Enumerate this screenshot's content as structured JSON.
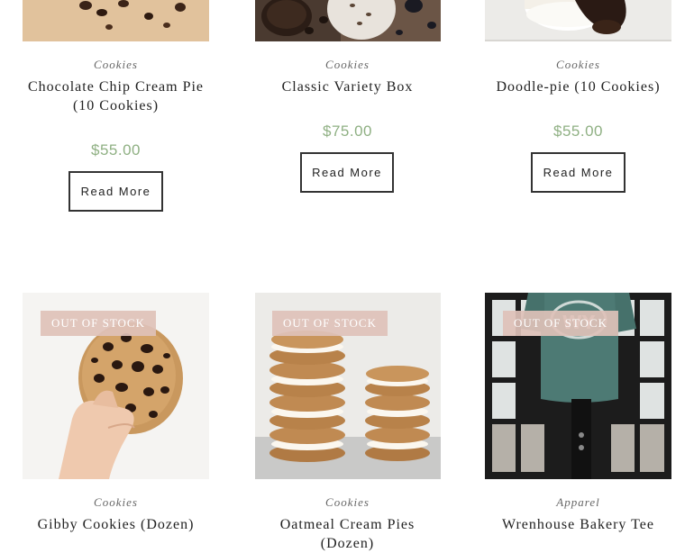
{
  "products": [
    {
      "category": "Cookies",
      "title": "Chocolate Chip Cream Pie (10 Cookies)",
      "price": "$55.00",
      "button": "Read More"
    },
    {
      "category": "Cookies",
      "title": "Classic Variety Box",
      "price": "$75.00",
      "button": "Read More"
    },
    {
      "category": "Cookies",
      "title": "Doodle-pie (10 Cookies)",
      "price": "$55.00",
      "button": "Read More"
    },
    {
      "category": "Cookies",
      "title": "Gibby Cookies (Dozen)",
      "badge": "OUT OF STOCK"
    },
    {
      "category": "Cookies",
      "title": "Oatmeal Cream Pies (Dozen)",
      "badge": "OUT OF STOCK"
    },
    {
      "category": "Apparel",
      "title": "Wrenhouse Bakery Tee",
      "badge": "OUT OF STOCK"
    }
  ],
  "colors": {
    "price": "#8fb083",
    "badge": "#dec1b8",
    "text": "#222222"
  }
}
